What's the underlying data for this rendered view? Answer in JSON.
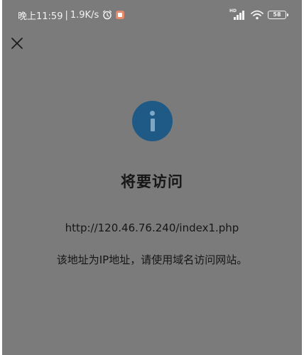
{
  "status_bar": {
    "time": "晚上11:59",
    "separator": "|",
    "net_speed": "1.9K/s",
    "battery_level": "58",
    "icons": [
      "alarm-icon",
      "app-badge-icon",
      "signal-icon",
      "wifi-icon",
      "battery-icon"
    ]
  },
  "toolbar": {
    "close_icon": "close-icon"
  },
  "dialog": {
    "icon": "info-icon",
    "icon_color": "#1f5a86",
    "title": "将要访问",
    "url": "http://120.46.76.240/index1.php",
    "message": "该地址为IP地址，请使用域名访问网站。"
  },
  "colors": {
    "background": "#7b7b7b",
    "text": "#161616"
  }
}
